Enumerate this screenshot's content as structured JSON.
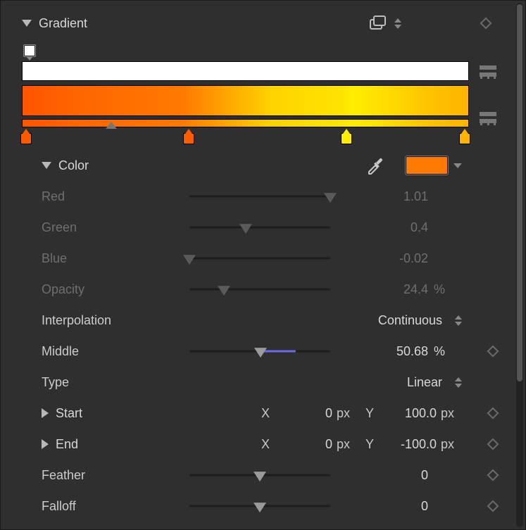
{
  "header": {
    "title": "Gradient"
  },
  "gradient": {
    "stops": [
      {
        "pos": 0,
        "color": "#ff5a00"
      },
      {
        "pos": 37,
        "color": "#ff5c00"
      },
      {
        "pos": 73,
        "color": "#ffee00"
      },
      {
        "pos": 100,
        "color": "#ffb400"
      }
    ],
    "middles": [
      {
        "pos": 19.5
      }
    ]
  },
  "color": {
    "label": "Color",
    "swatch": "#ff7a00",
    "red": {
      "label": "Red",
      "value": "1.01",
      "slider": 100
    },
    "green": {
      "label": "Green",
      "value": "0.4",
      "slider": 40
    },
    "blue": {
      "label": "Blue",
      "value": "-0.02",
      "slider": 0
    },
    "opacity": {
      "label": "Opacity",
      "value": "24.4",
      "unit": "%",
      "slider": 24.4
    }
  },
  "interpolation": {
    "label": "Interpolation",
    "value": "Continuous"
  },
  "middle": {
    "label": "Middle",
    "value": "50.68",
    "unit": "%",
    "slider": 50.68
  },
  "type": {
    "label": "Type",
    "value": "Linear"
  },
  "start": {
    "label": "Start",
    "x": "0",
    "y": "100.0",
    "unit": "px"
  },
  "end": {
    "label": "End",
    "x": "0",
    "y": "-100.0",
    "unit": "px"
  },
  "feather": {
    "label": "Feather",
    "value": "0",
    "slider": 50
  },
  "falloff": {
    "label": "Falloff",
    "value": "0",
    "slider": 50
  }
}
